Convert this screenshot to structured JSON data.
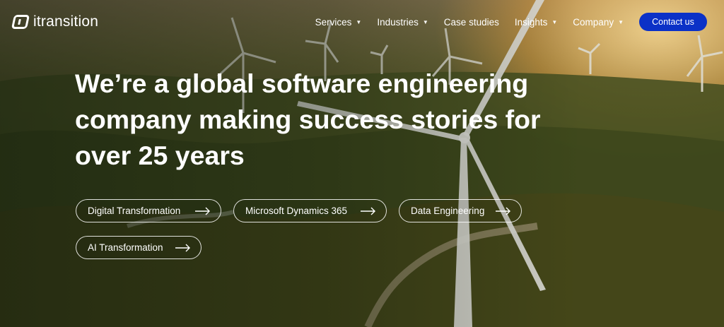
{
  "brand": {
    "name": "itransition"
  },
  "nav": {
    "items": [
      {
        "label": "Services",
        "has_dropdown": true
      },
      {
        "label": "Industries",
        "has_dropdown": true
      },
      {
        "label": "Case studies",
        "has_dropdown": false
      },
      {
        "label": "Insights",
        "has_dropdown": true
      },
      {
        "label": "Company",
        "has_dropdown": true
      }
    ],
    "contact_label": "Contact us"
  },
  "hero": {
    "headline": "We’re a global software engineering company making success stories for over 25 years",
    "pills": [
      "Digital Transformation",
      "Microsoft Dynamics 365",
      "Data Engineering",
      "AI Transformation"
    ]
  },
  "colors": {
    "accent": "#0b31c7",
    "text": "#ffffff"
  },
  "icons": {
    "logo": "itransition-logo-icon",
    "dropdown": "chevron-down-icon",
    "pill_arrow": "arrow-right-icon"
  }
}
